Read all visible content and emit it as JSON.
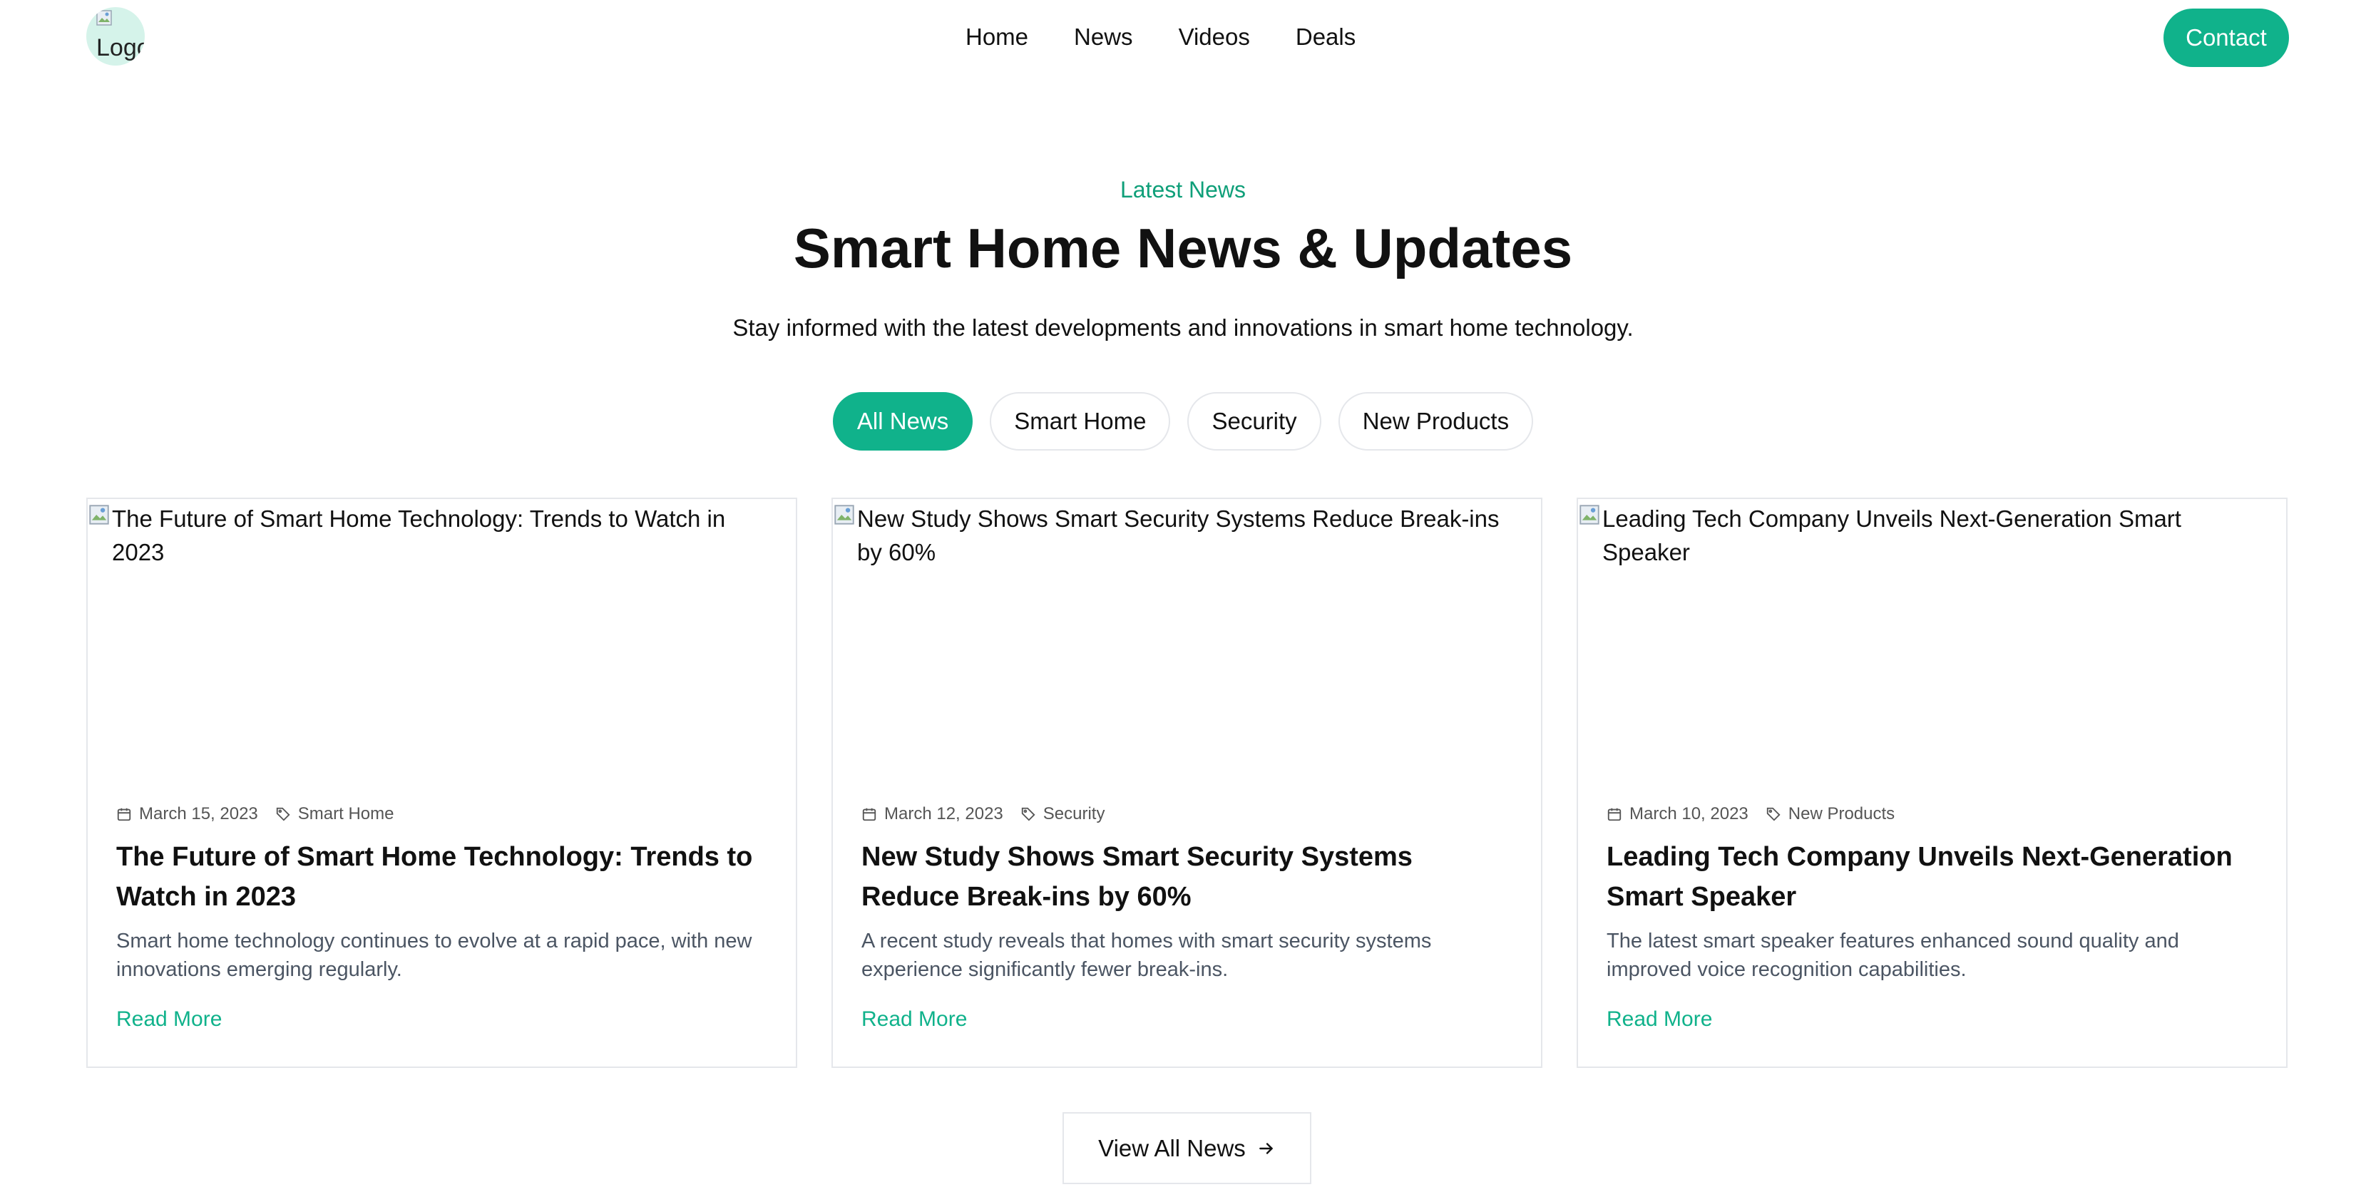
{
  "header": {
    "logo_alt": "Logo",
    "nav": [
      "Home",
      "News",
      "Videos",
      "Deals"
    ],
    "contact_label": "Contact"
  },
  "hero": {
    "eyebrow": "Latest News",
    "title": "Smart Home News & Updates",
    "subtitle": "Stay informed with the latest developments and innovations in smart home technology."
  },
  "filters": {
    "items": [
      "All News",
      "Smart Home",
      "Security",
      "New Products"
    ],
    "active": "All News"
  },
  "cards": [
    {
      "image_alt": "The Future of Smart Home Technology: Trends to Watch in 2023",
      "date": "March 15, 2023",
      "category": "Smart Home",
      "title": "The Future of Smart Home Technology: Trends to Watch in 2023",
      "description": "Smart home technology continues to evolve at a rapid pace, with new innovations emerging regularly.",
      "read_more": "Read More"
    },
    {
      "image_alt": "New Study Shows Smart Security Systems Reduce Break-ins by 60%",
      "date": "March 12, 2023",
      "category": "Security",
      "title": "New Study Shows Smart Security Systems Reduce Break-ins by 60%",
      "description": "A recent study reveals that homes with smart security systems experience significantly fewer break-ins.",
      "read_more": "Read More"
    },
    {
      "image_alt": "Leading Tech Company Unveils Next-Generation Smart Speaker",
      "date": "March 10, 2023",
      "category": "New Products",
      "title": "Leading Tech Company Unveils Next-Generation Smart Speaker",
      "description": "The latest smart speaker features enhanced sound quality and improved voice recognition capabilities.",
      "read_more": "Read More"
    }
  ],
  "view_all_label": "View All News",
  "icons": {
    "date": "calendar-icon",
    "category": "tag-icon",
    "view_all": "arrow-right-icon",
    "broken_image": "broken-image-icon"
  },
  "colors": {
    "accent": "#10b28b",
    "eyebrow": "#0f9f79",
    "logo_bg": "#d5f3ea",
    "border": "#e5e7eb",
    "muted_text": "#4b5563"
  }
}
